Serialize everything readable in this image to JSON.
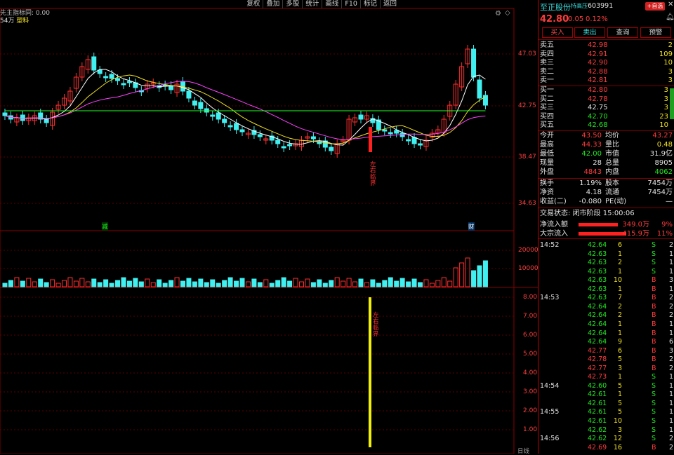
{
  "toolbar": [
    "复权",
    "叠加",
    "多股",
    "统计",
    "画线",
    "F10",
    "标记",
    "返回"
  ],
  "chart": {
    "indicator_title": "先主指标同: 0.00",
    "sub_legend_a": "54万",
    "sub_legend_b": "塑料",
    "price_ticks": [
      "47.03",
      "42.75",
      "38.47",
      "34.63"
    ],
    "vol_ticks": [
      "20000",
      "10000"
    ],
    "ind_ticks": [
      "8.00",
      "7.00",
      "6.00",
      "5.00",
      "4.00",
      "3.00",
      "2.00",
      "1.00"
    ],
    "tag_top": "左右临界",
    "tag_bottom": "左右临界",
    "marker_a": "减",
    "marker_b": "财",
    "bottom_tag": "日线",
    "colors": {
      "up": "#ff3030",
      "down": "#40f0f0",
      "ma5": "#ffffff",
      "ma10": "#f0e020",
      "ma20": "#ff40ff",
      "ma60": "#20ff20",
      "grid": "#8a0000"
    }
  },
  "header": {
    "name": "至正股份",
    "tag": "持高压",
    "code": "603991",
    "self_select": "+自选",
    "price": "42.80",
    "change": "0.05",
    "pct": "0.12%"
  },
  "actions": [
    "买入",
    "卖出",
    "查询",
    "预警"
  ],
  "asks": [
    {
      "label": "卖五",
      "price": "42.98",
      "vol": "2"
    },
    {
      "label": "卖四",
      "price": "42.91",
      "vol": "109"
    },
    {
      "label": "卖三",
      "price": "42.90",
      "vol": "10"
    },
    {
      "label": "卖二",
      "price": "42.88",
      "vol": "3"
    },
    {
      "label": "卖一",
      "price": "42.81",
      "vol": "3"
    }
  ],
  "bids": [
    {
      "label": "买一",
      "price": "42.80",
      "vol": "3"
    },
    {
      "label": "买二",
      "price": "42.78",
      "vol": "3"
    },
    {
      "label": "买三",
      "price": "42.75",
      "vol": "3"
    },
    {
      "label": "买四",
      "price": "42.70",
      "vol": "23"
    },
    {
      "label": "买五",
      "price": "42.68",
      "vol": "10"
    }
  ],
  "stats": [
    {
      "l1": "今开",
      "v1": "43.50",
      "l2": "均价",
      "v2": "43.27"
    },
    {
      "l1": "最高",
      "v1": "44.33",
      "l2": "量比",
      "v2": "0.48"
    },
    {
      "l1": "最低",
      "v1": "42.00",
      "l2": "市值",
      "v2": "31.9亿"
    },
    {
      "l1": "现量",
      "v1": "28",
      "l2": "总量",
      "v2": "8905"
    },
    {
      "l1": "外盘",
      "v1": "4843",
      "l2": "内盘",
      "v2": "4062"
    }
  ],
  "stats2": [
    {
      "l1": "换手",
      "v1": "1.19%",
      "l2": "股本",
      "v2": "7454万"
    },
    {
      "l1": "净资",
      "v1": "4.18",
      "l2": "流通",
      "v2": "7454万"
    },
    {
      "l1": "收益(二)",
      "v1": "-0.080",
      "l2": "PE(动)",
      "v2": "—"
    }
  ],
  "trade_status": "交易状态: 闭市阶段 15:00:06",
  "flows": [
    {
      "label": "净流入额",
      "value": "349.0万",
      "pct": "9%",
      "fill": 0.09
    },
    {
      "label": "大宗流入",
      "value": "415.9万",
      "pct": "11%",
      "fill": 0.11
    }
  ],
  "ticks": [
    {
      "time": "14:52",
      "price": "42.64",
      "vol": "6",
      "side": "S",
      "n": "2"
    },
    {
      "time": "",
      "price": "42.63",
      "vol": "1",
      "side": "S",
      "n": "1"
    },
    {
      "time": "",
      "price": "42.63",
      "vol": "2",
      "side": "S",
      "n": "1"
    },
    {
      "time": "",
      "price": "42.63",
      "vol": "1",
      "side": "S",
      "n": "1"
    },
    {
      "time": "",
      "price": "42.63",
      "vol": "10",
      "side": "B",
      "n": "3"
    },
    {
      "time": "",
      "price": "42.63",
      "vol": "1",
      "side": "B",
      "n": "1"
    },
    {
      "time": "14:53",
      "price": "42.63",
      "vol": "7",
      "side": "B",
      "n": "2"
    },
    {
      "time": "",
      "price": "42.64",
      "vol": "2",
      "side": "B",
      "n": "2"
    },
    {
      "time": "",
      "price": "42.64",
      "vol": "2",
      "side": "B",
      "n": "2"
    },
    {
      "time": "",
      "price": "42.64",
      "vol": "1",
      "side": "B",
      "n": "1"
    },
    {
      "time": "",
      "price": "42.64",
      "vol": "1",
      "side": "B",
      "n": "1"
    },
    {
      "time": "",
      "price": "42.64",
      "vol": "9",
      "side": "B",
      "n": "6"
    },
    {
      "time": "",
      "price": "42.77",
      "vol": "6",
      "side": "B",
      "n": "3"
    },
    {
      "time": "",
      "price": "42.78",
      "vol": "5",
      "side": "B",
      "n": "2"
    },
    {
      "time": "",
      "price": "42.77",
      "vol": "3",
      "side": "B",
      "n": "2"
    },
    {
      "time": "",
      "price": "42.73",
      "vol": "1",
      "side": "S",
      "n": "1"
    },
    {
      "time": "14:54",
      "price": "42.60",
      "vol": "5",
      "side": "S",
      "n": "1"
    },
    {
      "time": "",
      "price": "42.61",
      "vol": "1",
      "side": "S",
      "n": "1"
    },
    {
      "time": "",
      "price": "42.61",
      "vol": "5",
      "side": "S",
      "n": "1"
    },
    {
      "time": "14:55",
      "price": "42.61",
      "vol": "5",
      "side": "S",
      "n": "1"
    },
    {
      "time": "",
      "price": "42.61",
      "vol": "10",
      "side": "S",
      "n": "1"
    },
    {
      "time": "",
      "price": "42.62",
      "vol": "3",
      "side": "S",
      "n": "1"
    },
    {
      "time": "14:56",
      "price": "42.62",
      "vol": "12",
      "side": "S",
      "n": "2"
    },
    {
      "time": "",
      "price": "42.69",
      "vol": "16",
      "side": "B",
      "n": "2"
    }
  ]
}
